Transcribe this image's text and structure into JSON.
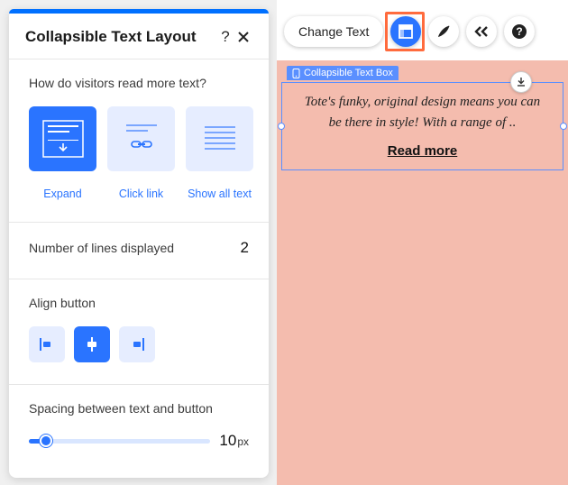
{
  "panel": {
    "title": "Collapsible Text Layout",
    "sections": {
      "readMode": {
        "label": "How do visitors read more text?",
        "options": [
          "Expand",
          "Click link",
          "Show all text"
        ],
        "selectedIndex": 0
      },
      "lines": {
        "label": "Number of lines displayed",
        "value": "2"
      },
      "align": {
        "label": "Align button",
        "selectedIndex": 1
      },
      "spacing": {
        "label": "Spacing between text and button",
        "value": "10",
        "unit": "px"
      }
    }
  },
  "toolbar": {
    "changeText": "Change Text"
  },
  "canvas": {
    "elementTag": "Collapsible Text Box",
    "text": "Tote's funky, original design means you can be there in style! With a range of ..",
    "readMore": "Read more"
  }
}
